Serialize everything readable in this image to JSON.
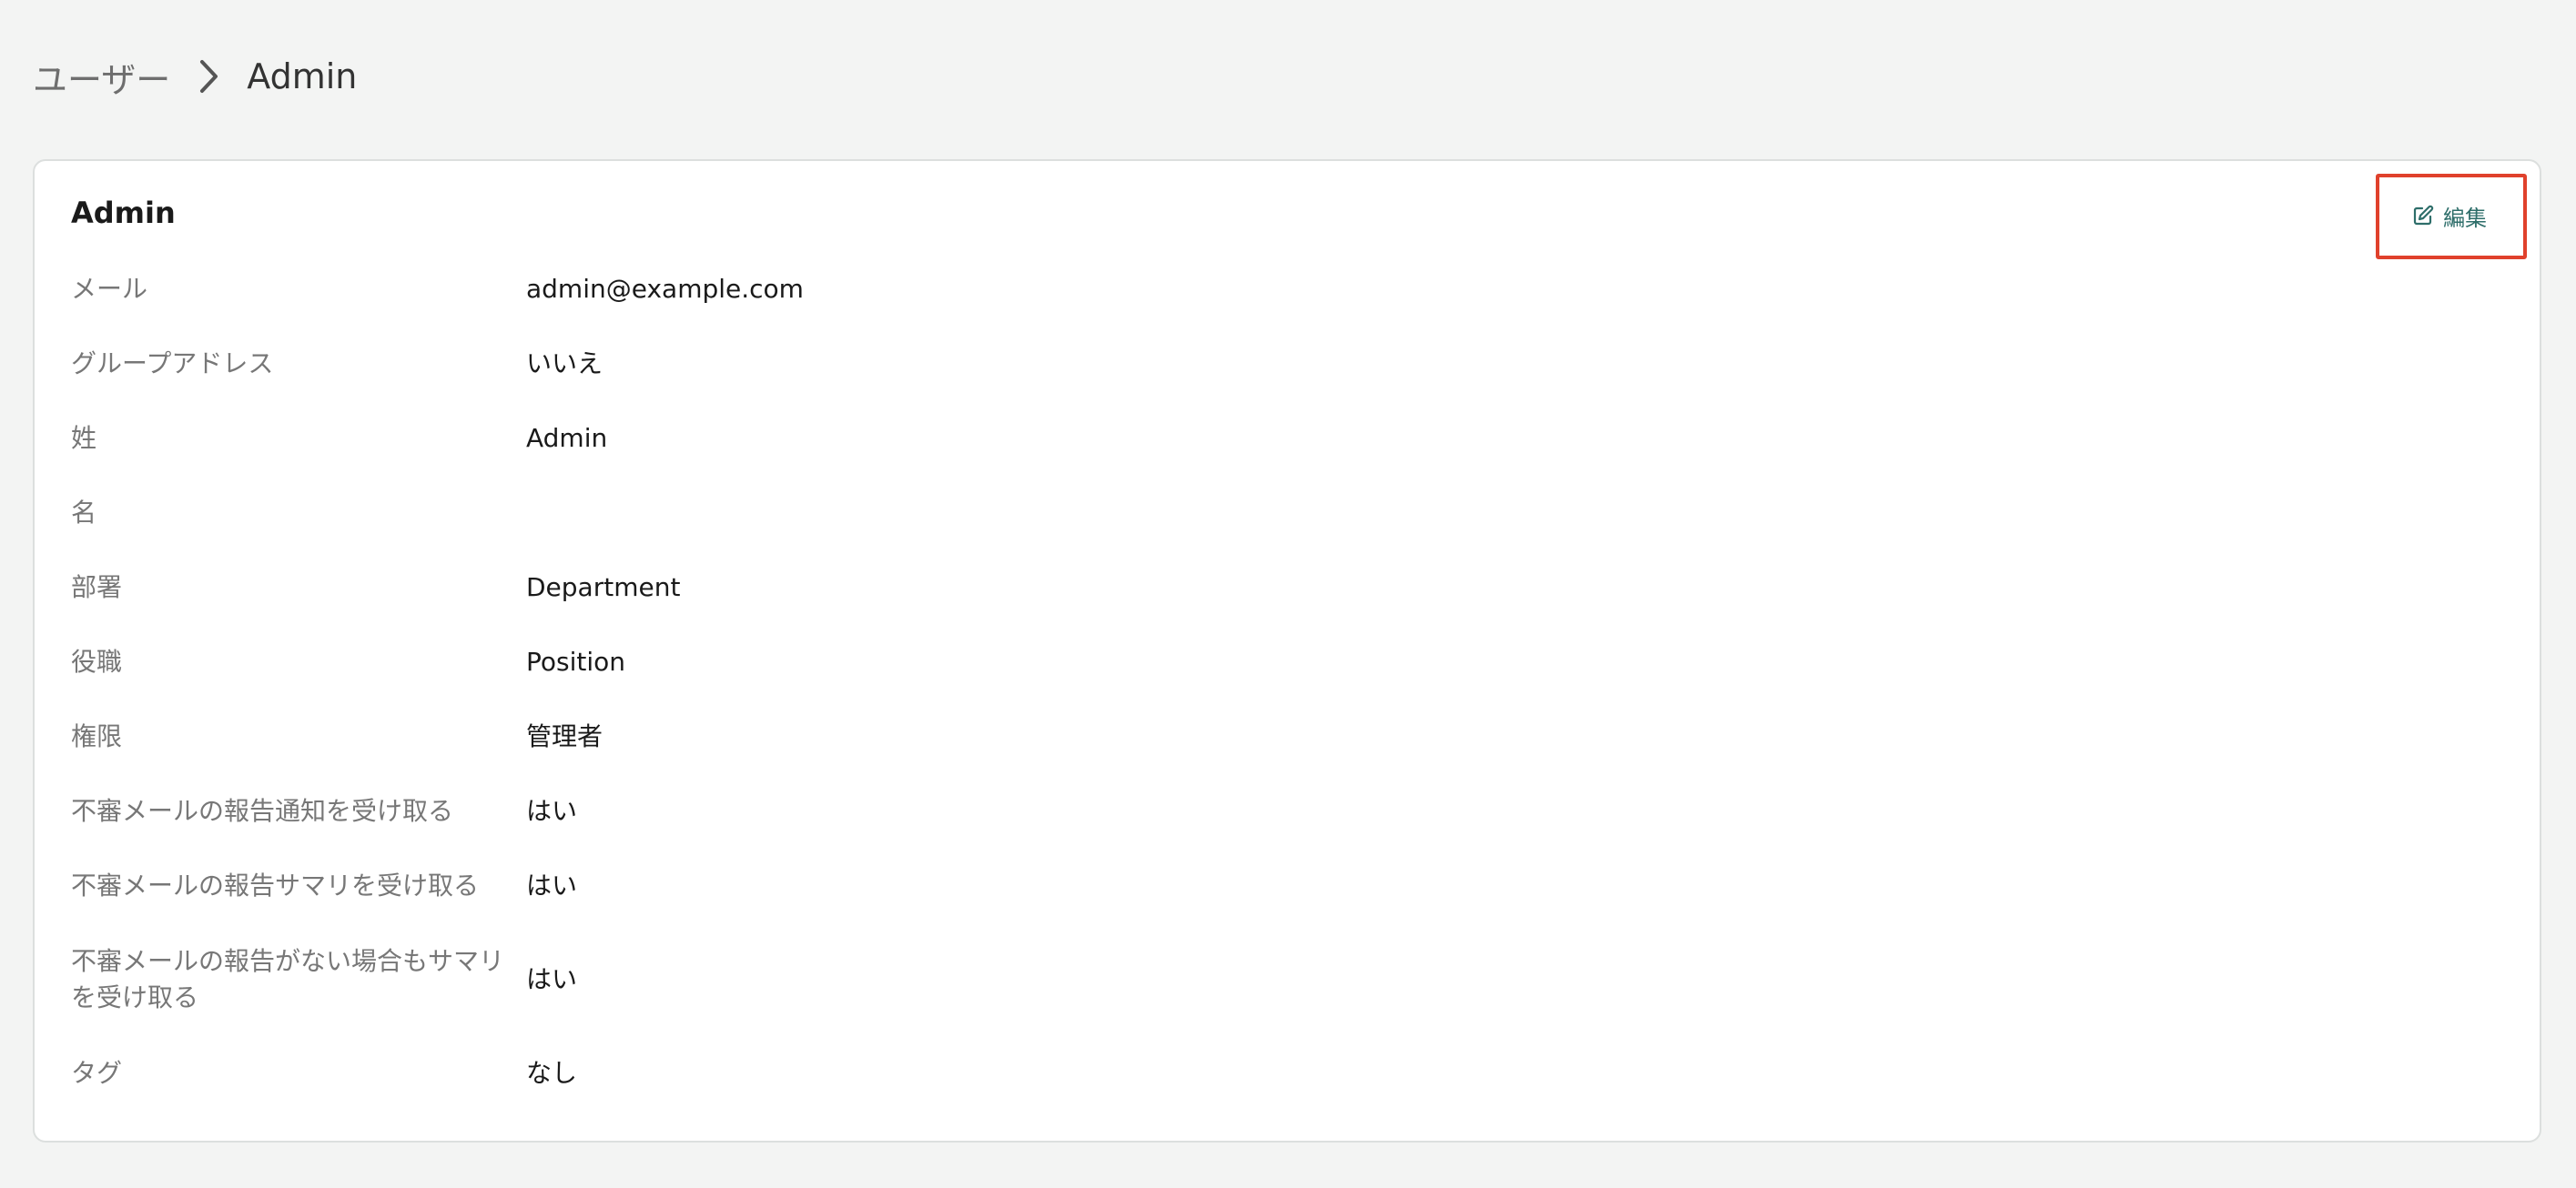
{
  "breadcrumb": {
    "parent": "ユーザー",
    "current": "Admin"
  },
  "card": {
    "title": "Admin",
    "edit_label": "編集"
  },
  "fields": [
    {
      "label": "メール",
      "value": "admin@example.com"
    },
    {
      "label": "グループアドレス",
      "value": "いいえ"
    },
    {
      "label": "姓",
      "value": "Admin"
    },
    {
      "label": "名",
      "value": ""
    },
    {
      "label": "部署",
      "value": "Department"
    },
    {
      "label": "役職",
      "value": "Position"
    },
    {
      "label": "権限",
      "value": "管理者"
    },
    {
      "label": "不審メールの報告通知を受け取る",
      "value": "はい"
    },
    {
      "label": "不審メールの報告サマリを受け取る",
      "value": "はい"
    },
    {
      "label": "不審メールの報告がない場合もサマリを受け取る",
      "value": "はい"
    },
    {
      "label": "タグ",
      "value": "なし"
    }
  ],
  "colors": {
    "accent": "#2e6e6a",
    "highlight": "#e0412c",
    "background": "#f3f4f3"
  },
  "icons": {
    "breadcrumb_separator": "chevron-right-icon",
    "edit": "edit-icon"
  }
}
